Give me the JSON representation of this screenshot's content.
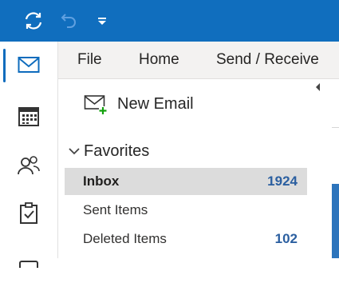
{
  "titlebar": {
    "sync_icon": "sync-icon",
    "undo_icon": "undo-icon",
    "qat_icon": "customize-quick-access-icon",
    "brand_color": "#106ebe"
  },
  "rail": {
    "items": [
      "mail-icon",
      "calendar-icon",
      "people-icon",
      "tasks-icon",
      "more-icon"
    ]
  },
  "ribbon": {
    "tabs": [
      "File",
      "Home",
      "Send / Receive"
    ]
  },
  "pane": {
    "new_email_label": "New Email",
    "favorites_label": "Favorites",
    "folders": [
      {
        "name": "Inbox",
        "count": "1924",
        "selected": true
      },
      {
        "name": "Sent Items",
        "count": "",
        "selected": false
      },
      {
        "name": "Deleted Items",
        "count": "102",
        "selected": false
      }
    ]
  }
}
